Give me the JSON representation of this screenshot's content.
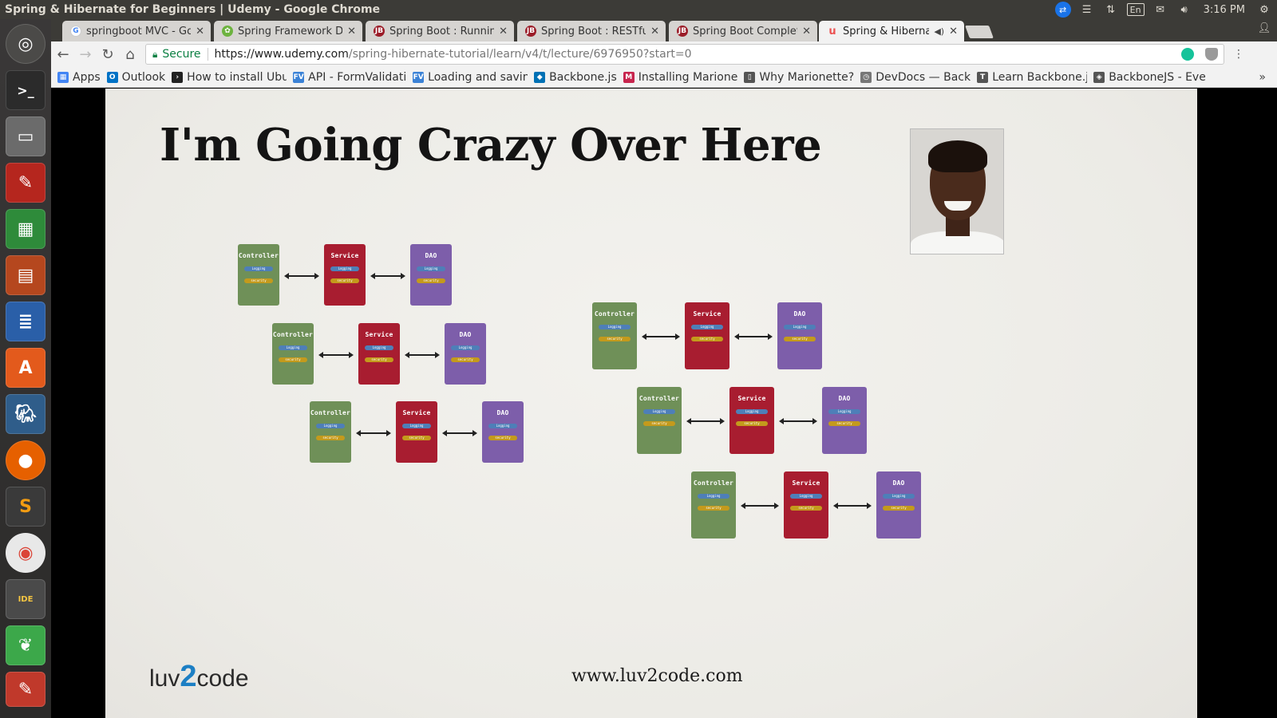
{
  "window": {
    "title": "Spring & Hibernate for Beginners | Udemy - Google Chrome"
  },
  "tray": {
    "language": "En",
    "clock": "3:16 PM"
  },
  "tabs": [
    {
      "label": "springboot MVC - Go",
      "favicon": "google-icon",
      "color": "#4285f4",
      "active": false
    },
    {
      "label": "Spring Framework Do",
      "favicon": "spring-icon",
      "color": "#6db33f",
      "active": false
    },
    {
      "label": "Spring Boot : Runnin",
      "favicon": "javabrains-icon",
      "color": "#9b1c28",
      "active": false
    },
    {
      "label": "Spring Boot : RESTful",
      "favicon": "javabrains-icon",
      "color": "#9b1c28",
      "active": false
    },
    {
      "label": "Spring Boot Complet",
      "favicon": "javabrains-icon",
      "color": "#9b1c28",
      "active": false
    },
    {
      "label": "Spring & Hibernate",
      "favicon": "udemy-icon",
      "color": "#ec5252",
      "active": true
    }
  ],
  "toolbar": {
    "secure_label": "Secure",
    "url_host": "https://www.udemy.com",
    "url_path": "/spring-hibernate-tutorial/learn/v4/t/lecture/6976950?start=0"
  },
  "bookmarks": [
    {
      "label": "Apps",
      "icon": "apps-grid-icon",
      "color": "#4285f4"
    },
    {
      "label": "Outlook",
      "icon": "outlook-icon",
      "color": "#0072c6"
    },
    {
      "label": "How to install Ubu",
      "icon": "terminal-icon",
      "color": "#222222"
    },
    {
      "label": "API - FormValidati",
      "icon": "fv-icon",
      "color": "#3b82d6"
    },
    {
      "label": "Loading and saving",
      "icon": "fv-icon",
      "color": "#3b82d6"
    },
    {
      "label": "Backbone.js",
      "icon": "backbone-icon",
      "color": "#0071b5"
    },
    {
      "label": "Installing Marione",
      "icon": "marionette-icon",
      "color": "#c7254e"
    },
    {
      "label": "Why Marionette?",
      "icon": "book-icon",
      "color": "#555555"
    },
    {
      "label": "DevDocs — Backb",
      "icon": "devdocs-icon",
      "color": "#777777"
    },
    {
      "label": "Learn Backbone.js",
      "icon": "text-icon",
      "color": "#555555"
    },
    {
      "label": "BackboneJS - Even",
      "icon": "diamond-icon",
      "color": "#555555"
    }
  ],
  "slide": {
    "title": "I'm Going Crazy Over Here",
    "brand_pre": "luv",
    "brand_two": "2",
    "brand_post": "code",
    "website": "www.luv2code.com",
    "layer_names": {
      "controller": "Controller",
      "service": "Service",
      "dao": "DAO"
    },
    "pills": {
      "logging": "Logging",
      "security": "security"
    }
  }
}
